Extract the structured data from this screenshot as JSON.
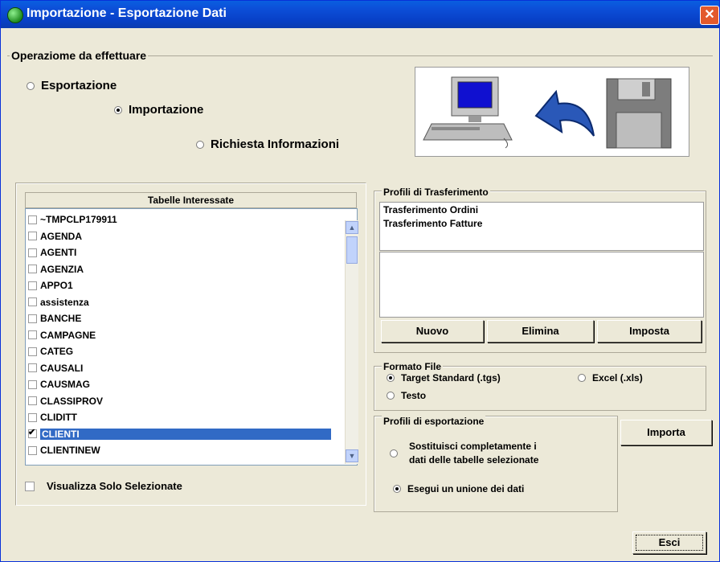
{
  "window": {
    "title": "Importazione - Esportazione Dati",
    "close_glyph": "✕"
  },
  "operation": {
    "legend": "Operaziome da effettuare",
    "options": [
      {
        "label": "Esportazione",
        "selected": false
      },
      {
        "label": "Importazione",
        "selected": true
      },
      {
        "label": "Richiesta Informazioni",
        "selected": false
      }
    ]
  },
  "tables": {
    "header": "Tabelle Interessate",
    "items": [
      {
        "label": "~TMPCLP179911",
        "checked": false,
        "selected": false
      },
      {
        "label": "AGENDA",
        "checked": false,
        "selected": false
      },
      {
        "label": "AGENTI",
        "checked": false,
        "selected": false
      },
      {
        "label": "AGENZIA",
        "checked": false,
        "selected": false
      },
      {
        "label": "APPO1",
        "checked": false,
        "selected": false
      },
      {
        "label": "assistenza",
        "checked": false,
        "selected": false
      },
      {
        "label": "BANCHE",
        "checked": false,
        "selected": false
      },
      {
        "label": "CAMPAGNE",
        "checked": false,
        "selected": false
      },
      {
        "label": "CATEG",
        "checked": false,
        "selected": false
      },
      {
        "label": "CAUSALI",
        "checked": false,
        "selected": false
      },
      {
        "label": "CAUSMAG",
        "checked": false,
        "selected": false
      },
      {
        "label": "CLASSIPROV",
        "checked": false,
        "selected": false
      },
      {
        "label": "CLIDITT",
        "checked": false,
        "selected": false
      },
      {
        "label": "CLIENTI",
        "checked": true,
        "selected": true
      },
      {
        "label": "CLIENTINEW",
        "checked": false,
        "selected": false
      }
    ],
    "show_selected_label": "Visualizza Solo Selezionate"
  },
  "transfer_profiles": {
    "legend": "Profili di Trasferimento",
    "items": [
      "Trasferimento Ordini",
      "Trasferimento Fatture"
    ],
    "buttons": {
      "new": "Nuovo",
      "delete": "Elimina",
      "set": "Imposta"
    }
  },
  "file_format": {
    "legend": "Formato File",
    "options": [
      {
        "label": "Target Standard (.tgs)",
        "selected": true
      },
      {
        "label": "Excel (.xls)",
        "selected": false
      },
      {
        "label": "Testo",
        "selected": false
      }
    ]
  },
  "export_profiles": {
    "legend": "Profili di esportazione",
    "option_replace_line1": "Sostituisci completamente i",
    "option_replace_line2": "dati delle tabelle selezionate",
    "option_merge": "Esegui un unione dei dati",
    "replace_selected": false,
    "merge_selected": true
  },
  "buttons": {
    "import": "Importa",
    "exit": "Esci"
  },
  "icons": {
    "app": "app-globe-icon",
    "computer": "computer-icon",
    "arrow": "curved-arrow-icon",
    "floppy": "floppy-disk-icon"
  }
}
